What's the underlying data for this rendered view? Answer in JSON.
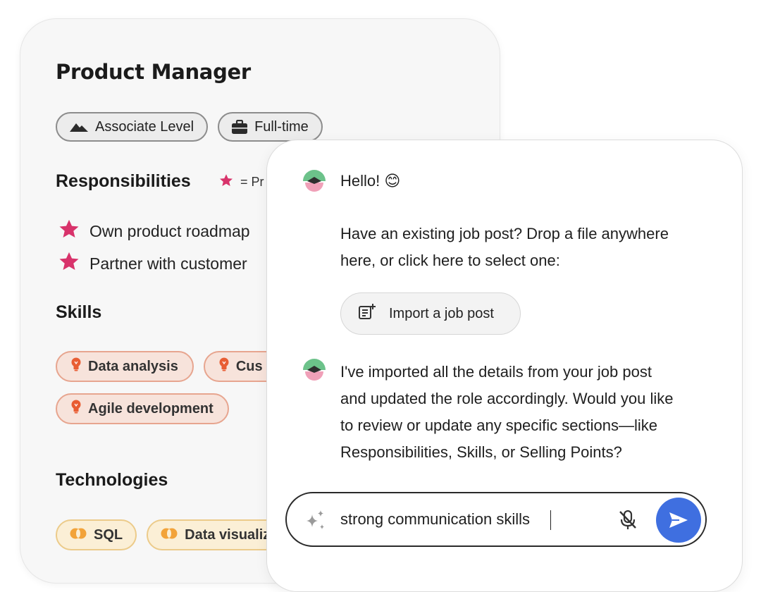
{
  "role": {
    "title": "Product Manager",
    "tags": {
      "level": "Associate Level",
      "type": "Full-time"
    },
    "responsibilities": {
      "heading": "Responsibilities",
      "legend_text": "= Pr",
      "items": [
        "Own product roadmap",
        "Partner with customer"
      ]
    },
    "skills": {
      "heading": "Skills",
      "items": [
        "Data analysis",
        "Cus",
        "Agile development"
      ]
    },
    "technologies": {
      "heading": "Technologies",
      "items": [
        "SQL",
        "Data visualiz"
      ]
    }
  },
  "chat": {
    "messages": [
      {
        "greeting": "Hello! 😊",
        "line1": "Have an existing job post? Drop a file anywhere",
        "line2": "here, or click here to select one:"
      },
      {
        "line1": "I've imported all the details from your job post",
        "line2": "and updated the role accordingly. Would you like",
        "line3": "to review or update any specific sections—like",
        "line4": "Responsibilities, Skills, or Selling Points?"
      }
    ],
    "import_button_label": "Import a job post",
    "input_value": "strong communication skills"
  },
  "colors": {
    "accent_star": "#d8336b",
    "send_button": "#3f6fe0",
    "skill_border": "#e7a58f",
    "tech_border": "#eccb8a",
    "bulb_icon": "#e85d33",
    "tech_icon": "#f2a33a"
  },
  "icons": [
    "mountain-icon",
    "briefcase-icon",
    "star-icon",
    "lightbulb-icon",
    "overlap-circles-icon",
    "avatar-icon",
    "add-document-icon",
    "sparkle-icon",
    "mic-off-icon",
    "send-icon"
  ]
}
